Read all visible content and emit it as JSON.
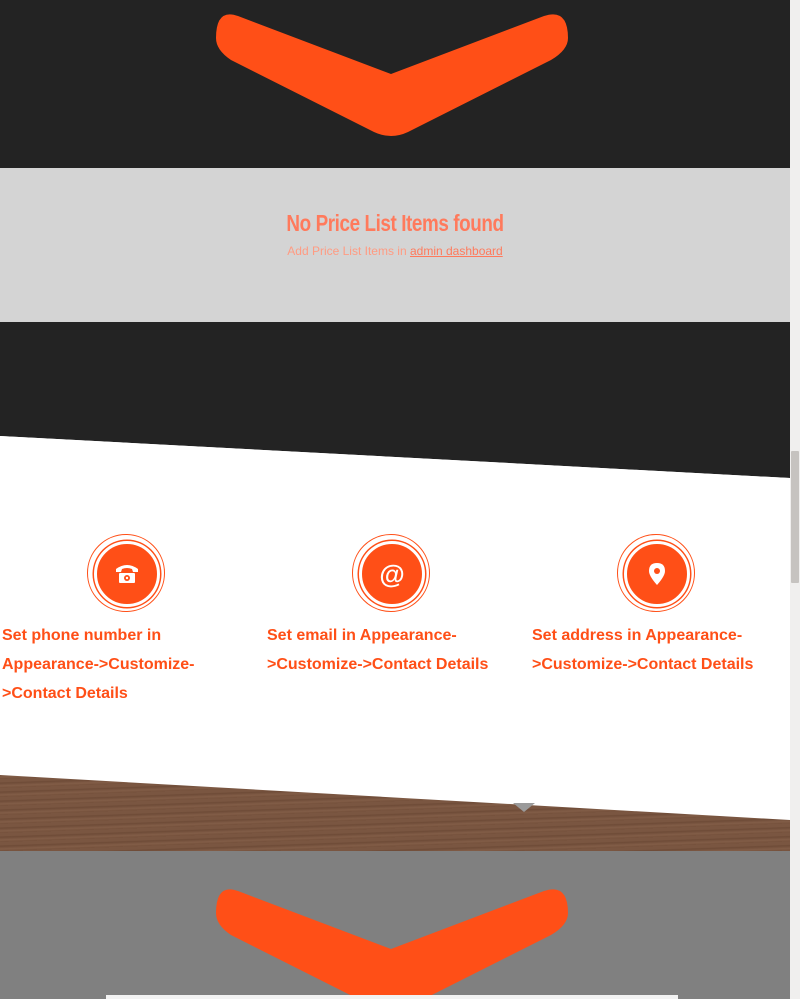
{
  "pricelist": {
    "title": "No Price List Items found",
    "subtitle_prefix": "Add Price List Items in ",
    "link_text": "admin dashboard"
  },
  "contact": {
    "items": [
      {
        "icon": "phone-icon",
        "text": "Set phone number in Appearance->Customize->Contact Details"
      },
      {
        "icon": "at-sign-icon",
        "text": "Set email in Appearance->Customize->Contact Details"
      },
      {
        "icon": "map-marker-icon",
        "text": "Set address in Appearance->Customize->Contact Details"
      }
    ]
  },
  "colors": {
    "accent": "#ff4f17",
    "dark": "#232323",
    "light_gray": "#d4d4d4",
    "gray": "#808080"
  }
}
